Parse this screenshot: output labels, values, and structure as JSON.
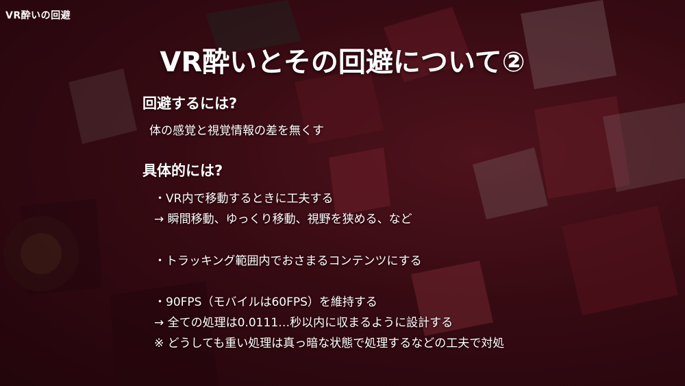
{
  "header": {
    "corner_label": "VR酔いの回避"
  },
  "slide": {
    "title": "VR酔いとその回避について②",
    "section1": {
      "heading": "回避するには?",
      "text": "体の感覚と視覚情報の差を無くす"
    },
    "section2": {
      "heading": "具体的には?",
      "lines": [
        "・VR内で移動するときに工夫する",
        "→ 瞬間移動、ゆっくり移動、視野を狭める、など",
        "・トラッキング範囲内でおさまるコンテンツにする",
        "・90FPS（モバイルは60FPS）を維持する",
        "→ 全ての処理は0.0111…秒以内に収まるように設計する",
        "※ どうしても重い処理は真っ暗な状態で処理するなどの工夫で対処"
      ]
    }
  }
}
